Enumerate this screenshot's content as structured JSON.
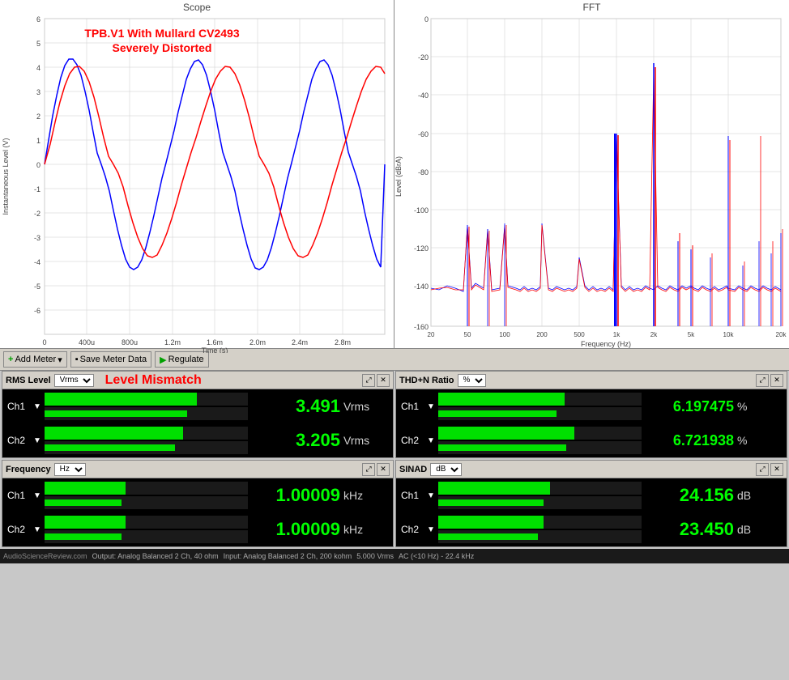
{
  "scope": {
    "title": "Scope",
    "subtitle_line1": "TPB.V1 With Mullard CV2493",
    "subtitle_line2": "Severely Distorted",
    "x_axis_label": "Time (s)",
    "y_axis_label": "Instantaneous Level (V)",
    "x_ticks": [
      "0",
      "400u",
      "800u",
      "1.2m",
      "1.6m",
      "2.0m",
      "2.4m",
      "2.8m"
    ],
    "y_ticks": [
      "6",
      "5",
      "4",
      "3",
      "2",
      "1",
      "0",
      "-1",
      "-2",
      "-3",
      "-4",
      "-5",
      "-6"
    ]
  },
  "fft": {
    "title": "FFT",
    "x_axis_label": "Frequency (Hz)",
    "y_axis_label": "Level (dBrA)",
    "x_ticks": [
      "20",
      "50",
      "100",
      "200",
      "500",
      "1k",
      "2k",
      "5k",
      "10k",
      "20k"
    ],
    "y_ticks": [
      "0",
      "-20",
      "-40",
      "-60",
      "-80",
      "-100",
      "-120",
      "-140",
      "-160"
    ]
  },
  "toolbar": {
    "add_meter_label": "Add Meter",
    "save_meter_label": "Save Meter Data",
    "regulate_label": "Regulate"
  },
  "rms_panel": {
    "title": "RMS Level",
    "unit": "Vrms",
    "mismatch_label": "Level Mismatch",
    "ch1_value": "3.491",
    "ch1_unit": "Vrms",
    "ch1_bar_pct": 75,
    "ch1_bar2_pct": 72,
    "ch2_value": "3.205",
    "ch2_unit": "Vrms",
    "ch2_bar_pct": 68,
    "ch2_bar2_pct": 65
  },
  "thdn_panel": {
    "title": "THD+N Ratio",
    "unit": "%",
    "ch1_value": "6.197475",
    "ch1_unit": "%",
    "ch1_bar_pct": 62,
    "ch1_bar2_pct": 58,
    "ch2_value": "6.721938",
    "ch2_unit": "%",
    "ch2_bar_pct": 67,
    "ch2_bar2_pct": 63
  },
  "freq_panel": {
    "title": "Frequency",
    "unit": "Hz",
    "ch1_value": "1.00009",
    "ch1_unit": "kHz",
    "ch1_bar_pct": 40,
    "ch1_bar2_pct": 38,
    "ch2_value": "1.00009",
    "ch2_unit": "kHz",
    "ch2_bar_pct": 40,
    "ch2_bar2_pct": 38
  },
  "sinad_panel": {
    "title": "SINAD",
    "unit": "dB",
    "ch1_value": "24.156",
    "ch1_unit": "dB",
    "ch1_bar_pct": 55,
    "ch1_bar2_pct": 52,
    "ch2_value": "23.450",
    "ch2_unit": "dB",
    "ch2_bar_pct": 52,
    "ch2_bar2_pct": 50
  },
  "footer": {
    "output": "Output: Analog Balanced 2 Ch, 40 ohm",
    "input": "Input: Analog Balanced 2 Ch, 200 kohm",
    "level": "5.000 Vrms",
    "filter": "AC (<10 Hz) - 22.4 kHz"
  },
  "watermark": "AudioScienceReview.com"
}
